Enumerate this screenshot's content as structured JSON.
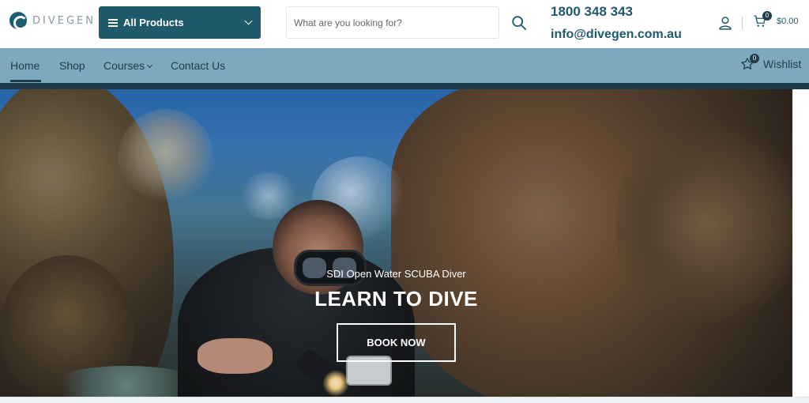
{
  "brand": {
    "name": "DIVEGEN"
  },
  "header": {
    "all_products_label": "All Products",
    "search_placeholder": "What are you looking for?",
    "phone": "1800 348 343",
    "email": "info@divegen.com.au",
    "cart_count": "0",
    "cart_total": "$0.00"
  },
  "nav": {
    "items": [
      {
        "label": "Home"
      },
      {
        "label": "Shop"
      },
      {
        "label": "Courses"
      },
      {
        "label": "Contact Us"
      }
    ],
    "active": "Home",
    "wishlist_label": "Wishlist",
    "wishlist_count": "0"
  },
  "hero": {
    "subtitle": "SDI Open Water SCUBA Diver",
    "title": "LEARN TO DIVE",
    "button_label": "BOOK NOW"
  },
  "colors": {
    "brand_dark": "#1e5a6c",
    "nav_bar": "#7ea8bd",
    "nav_bottom": "#213a47",
    "text": "#1f3d4e"
  },
  "icons": [
    "logo-icon",
    "menu-icon",
    "chevron-down-icon",
    "search-icon",
    "user-icon",
    "cart-icon",
    "star-icon"
  ]
}
